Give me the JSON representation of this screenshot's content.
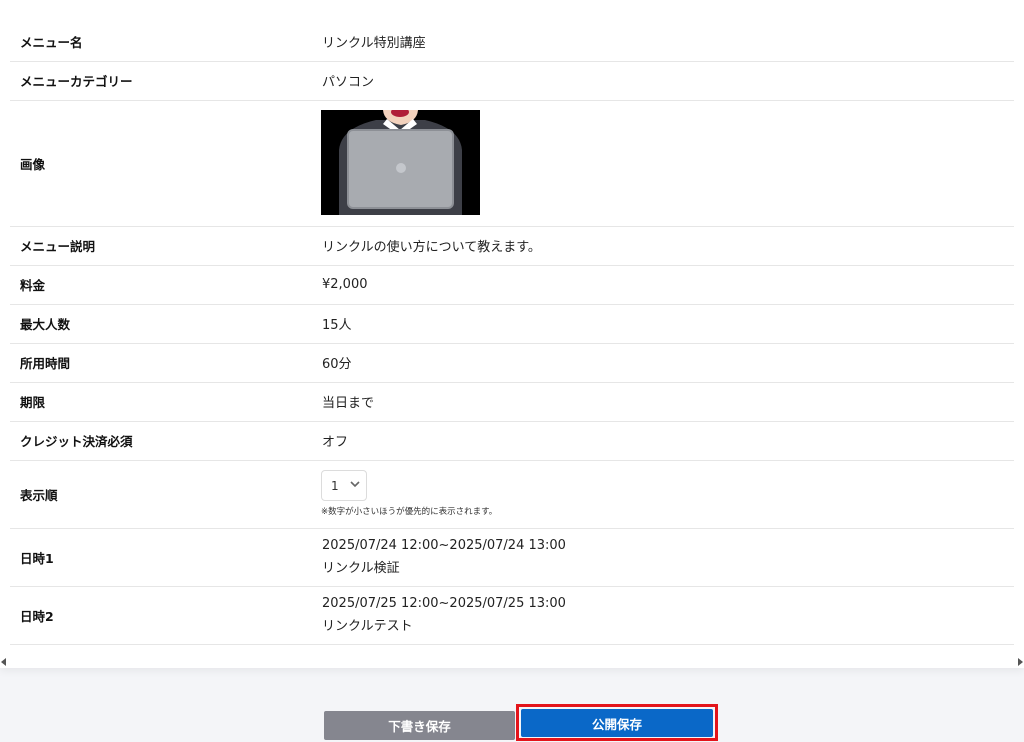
{
  "rows": [
    {
      "label": "メニュー名",
      "value": "リンクル特別講座"
    },
    {
      "label": "メニューカテゴリー",
      "value": "パソコン"
    },
    {
      "label": "画像"
    },
    {
      "label": "メニュー説明",
      "value": "リンクルの使い方について教えます。"
    },
    {
      "label": "料金",
      "value": "¥2,000"
    },
    {
      "label": "最大人数",
      "value": "15人"
    },
    {
      "label": "所用時間",
      "value": "60分"
    },
    {
      "label": "期限",
      "value": "当日まで"
    },
    {
      "label": "クレジット決済必須",
      "value": "オフ"
    },
    {
      "label": "表示順",
      "selected": "1",
      "note": "※数字が小さいほうが優先的に表示されます。"
    },
    {
      "label": "日時1",
      "line1": "2025/07/24 12:00~2025/07/24 13:00",
      "line2": "リンクル検証"
    },
    {
      "label": "日時2",
      "line1": "2025/07/25 12:00~2025/07/25 13:00",
      "line2": "リンクルテスト"
    }
  ],
  "buttons": {
    "draft": "下書き保存",
    "publish": "公開保存"
  },
  "colors": {
    "draft_button": "#85868f",
    "publish_button": "#0a68c8",
    "highlight_border": "#e3141b"
  }
}
